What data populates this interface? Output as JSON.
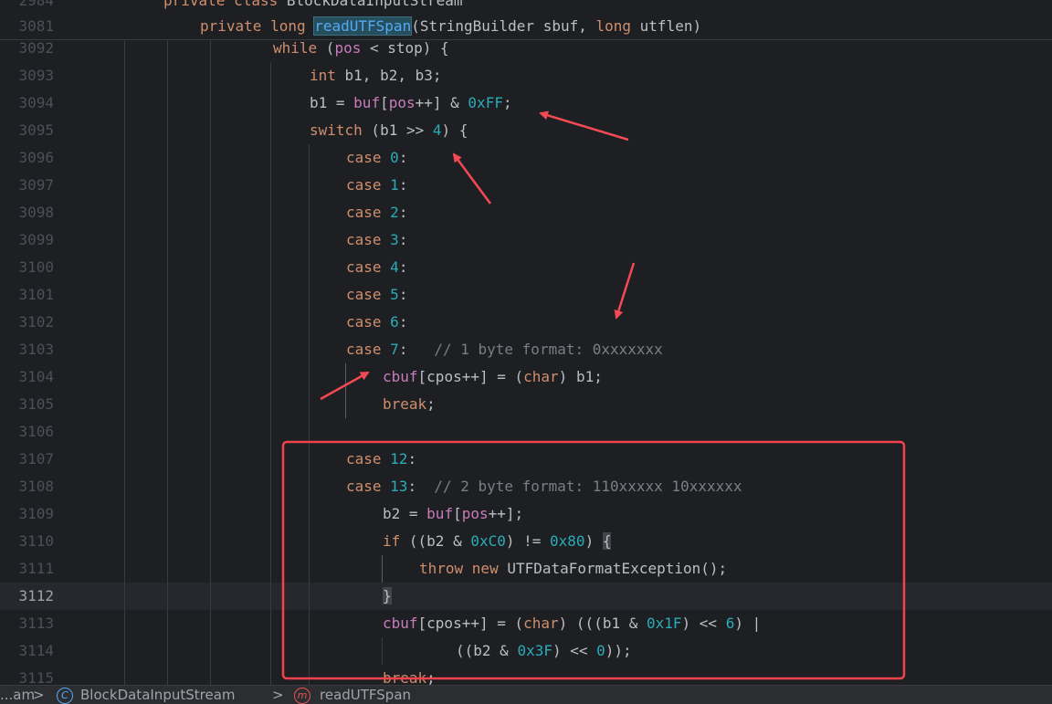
{
  "editor": {
    "sticky": [
      {
        "num": "2984",
        "html_tokens": [
          [
            "kw",
            "private class "
          ],
          [
            "p",
            "BlockDataInputStream"
          ]
        ]
      },
      {
        "num": "3081",
        "html_tokens": [
          [
            "kw",
            "private long "
          ],
          [
            "hlm",
            "readUTFSpan"
          ],
          [
            "p",
            "(StringBuilder sbuf, "
          ],
          [
            "kw",
            "long"
          ],
          [
            "p",
            " utflen)"
          ]
        ]
      }
    ],
    "lines": [
      {
        "num": "3092",
        "tokens": [
          [
            "kw",
            "while"
          ],
          [
            "p",
            " ("
          ],
          [
            "fld",
            "pos"
          ],
          [
            "p",
            " < stop) {"
          ]
        ]
      },
      {
        "num": "3093",
        "tokens": [
          [
            "kw",
            "int"
          ],
          [
            "p",
            " b1, b2, b3;"
          ]
        ]
      },
      {
        "num": "3094",
        "tokens": [
          [
            "p",
            "b1 = "
          ],
          [
            "fld",
            "buf"
          ],
          [
            "p",
            "["
          ],
          [
            "fld",
            "pos"
          ],
          [
            "p",
            "++] & "
          ],
          [
            "num",
            "0xFF"
          ],
          [
            "p",
            ";"
          ]
        ]
      },
      {
        "num": "3095",
        "tokens": [
          [
            "kw",
            "switch"
          ],
          [
            "p",
            " (b1 >> "
          ],
          [
            "num",
            "4"
          ],
          [
            "p",
            ") {"
          ]
        ]
      },
      {
        "num": "3096",
        "tokens": [
          [
            "kw",
            "case "
          ],
          [
            "num",
            "0"
          ],
          [
            "p",
            ":"
          ]
        ]
      },
      {
        "num": "3097",
        "tokens": [
          [
            "kw",
            "case "
          ],
          [
            "num",
            "1"
          ],
          [
            "p",
            ":"
          ]
        ]
      },
      {
        "num": "3098",
        "tokens": [
          [
            "kw",
            "case "
          ],
          [
            "num",
            "2"
          ],
          [
            "p",
            ":"
          ]
        ]
      },
      {
        "num": "3099",
        "tokens": [
          [
            "kw",
            "case "
          ],
          [
            "num",
            "3"
          ],
          [
            "p",
            ":"
          ]
        ]
      },
      {
        "num": "3100",
        "tokens": [
          [
            "kw",
            "case "
          ],
          [
            "num",
            "4"
          ],
          [
            "p",
            ":"
          ]
        ]
      },
      {
        "num": "3101",
        "tokens": [
          [
            "kw",
            "case "
          ],
          [
            "num",
            "5"
          ],
          [
            "p",
            ":"
          ]
        ]
      },
      {
        "num": "3102",
        "tokens": [
          [
            "kw",
            "case "
          ],
          [
            "num",
            "6"
          ],
          [
            "p",
            ":"
          ]
        ]
      },
      {
        "num": "3103",
        "tokens": [
          [
            "kw",
            "case "
          ],
          [
            "num",
            "7"
          ],
          [
            "p",
            ":   "
          ],
          [
            "cmt",
            "// 1 byte format: 0xxxxxxx"
          ]
        ]
      },
      {
        "num": "3104",
        "tokens": [
          [
            "fld",
            "cbuf"
          ],
          [
            "p",
            "["
          ],
          [
            "p",
            "cpos++] = ("
          ],
          [
            "kw",
            "char"
          ],
          [
            "p",
            ") b1;"
          ]
        ]
      },
      {
        "num": "3105",
        "tokens": [
          [
            "kw",
            "break"
          ],
          [
            "p",
            ";"
          ]
        ]
      },
      {
        "num": "3106",
        "tokens": []
      },
      {
        "num": "3107",
        "tokens": [
          [
            "kw",
            "case "
          ],
          [
            "num",
            "12"
          ],
          [
            "p",
            ":"
          ]
        ]
      },
      {
        "num": "3108",
        "tokens": [
          [
            "kw",
            "case "
          ],
          [
            "num",
            "13"
          ],
          [
            "p",
            ":  "
          ],
          [
            "cmt",
            "// 2 byte format: 110xxxxx 10xxxxxx"
          ]
        ]
      },
      {
        "num": "3109",
        "tokens": [
          [
            "p",
            "b2 = "
          ],
          [
            "fld",
            "buf"
          ],
          [
            "p",
            "["
          ],
          [
            "fld",
            "pos"
          ],
          [
            "p",
            "++];"
          ]
        ]
      },
      {
        "num": "3110",
        "tokens": [
          [
            "kw",
            "if"
          ],
          [
            "p",
            " ((b2 & "
          ],
          [
            "num",
            "0xC0"
          ],
          [
            "p",
            ") != "
          ],
          [
            "num",
            "0x80"
          ],
          [
            "p",
            ") "
          ],
          [
            "bh",
            "{"
          ]
        ]
      },
      {
        "num": "3111",
        "tokens": [
          [
            "kw",
            "throw new "
          ],
          [
            "p",
            "UTFDataFormatException();"
          ]
        ]
      },
      {
        "num": "3112",
        "tokens": [
          [
            "bh",
            "}"
          ]
        ]
      },
      {
        "num": "3113",
        "tokens": [
          [
            "fld",
            "cbuf"
          ],
          [
            "p",
            "[cpos++] = ("
          ],
          [
            "kw",
            "char"
          ],
          [
            "p",
            ") (((b1 & "
          ],
          [
            "num",
            "0x1F"
          ],
          [
            "p",
            ") << "
          ],
          [
            "num",
            "6"
          ],
          [
            "p",
            ") |"
          ]
        ]
      },
      {
        "num": "3114",
        "tokens": [
          [
            "p",
            "((b2 & "
          ],
          [
            "num",
            "0x3F"
          ],
          [
            "p",
            ") << "
          ],
          [
            "num",
            "0"
          ],
          [
            "p",
            "));"
          ]
        ]
      },
      {
        "num": "3115",
        "tokens": [
          [
            "kw",
            "break"
          ],
          [
            "p",
            ";"
          ]
        ]
      }
    ],
    "current_line": "3112"
  },
  "breadcrumb": {
    "items": [
      "...am",
      "BlockDataInputStream",
      "readUTFSpan"
    ],
    "separator": ">"
  },
  "colors": {
    "background": "#1e1f22",
    "keyword": "#cf8e6d",
    "number": "#2aacb8",
    "field": "#c77dbb",
    "comment": "#7a7e85",
    "text": "#bcbec4",
    "annotation_red": "#f2424b"
  }
}
